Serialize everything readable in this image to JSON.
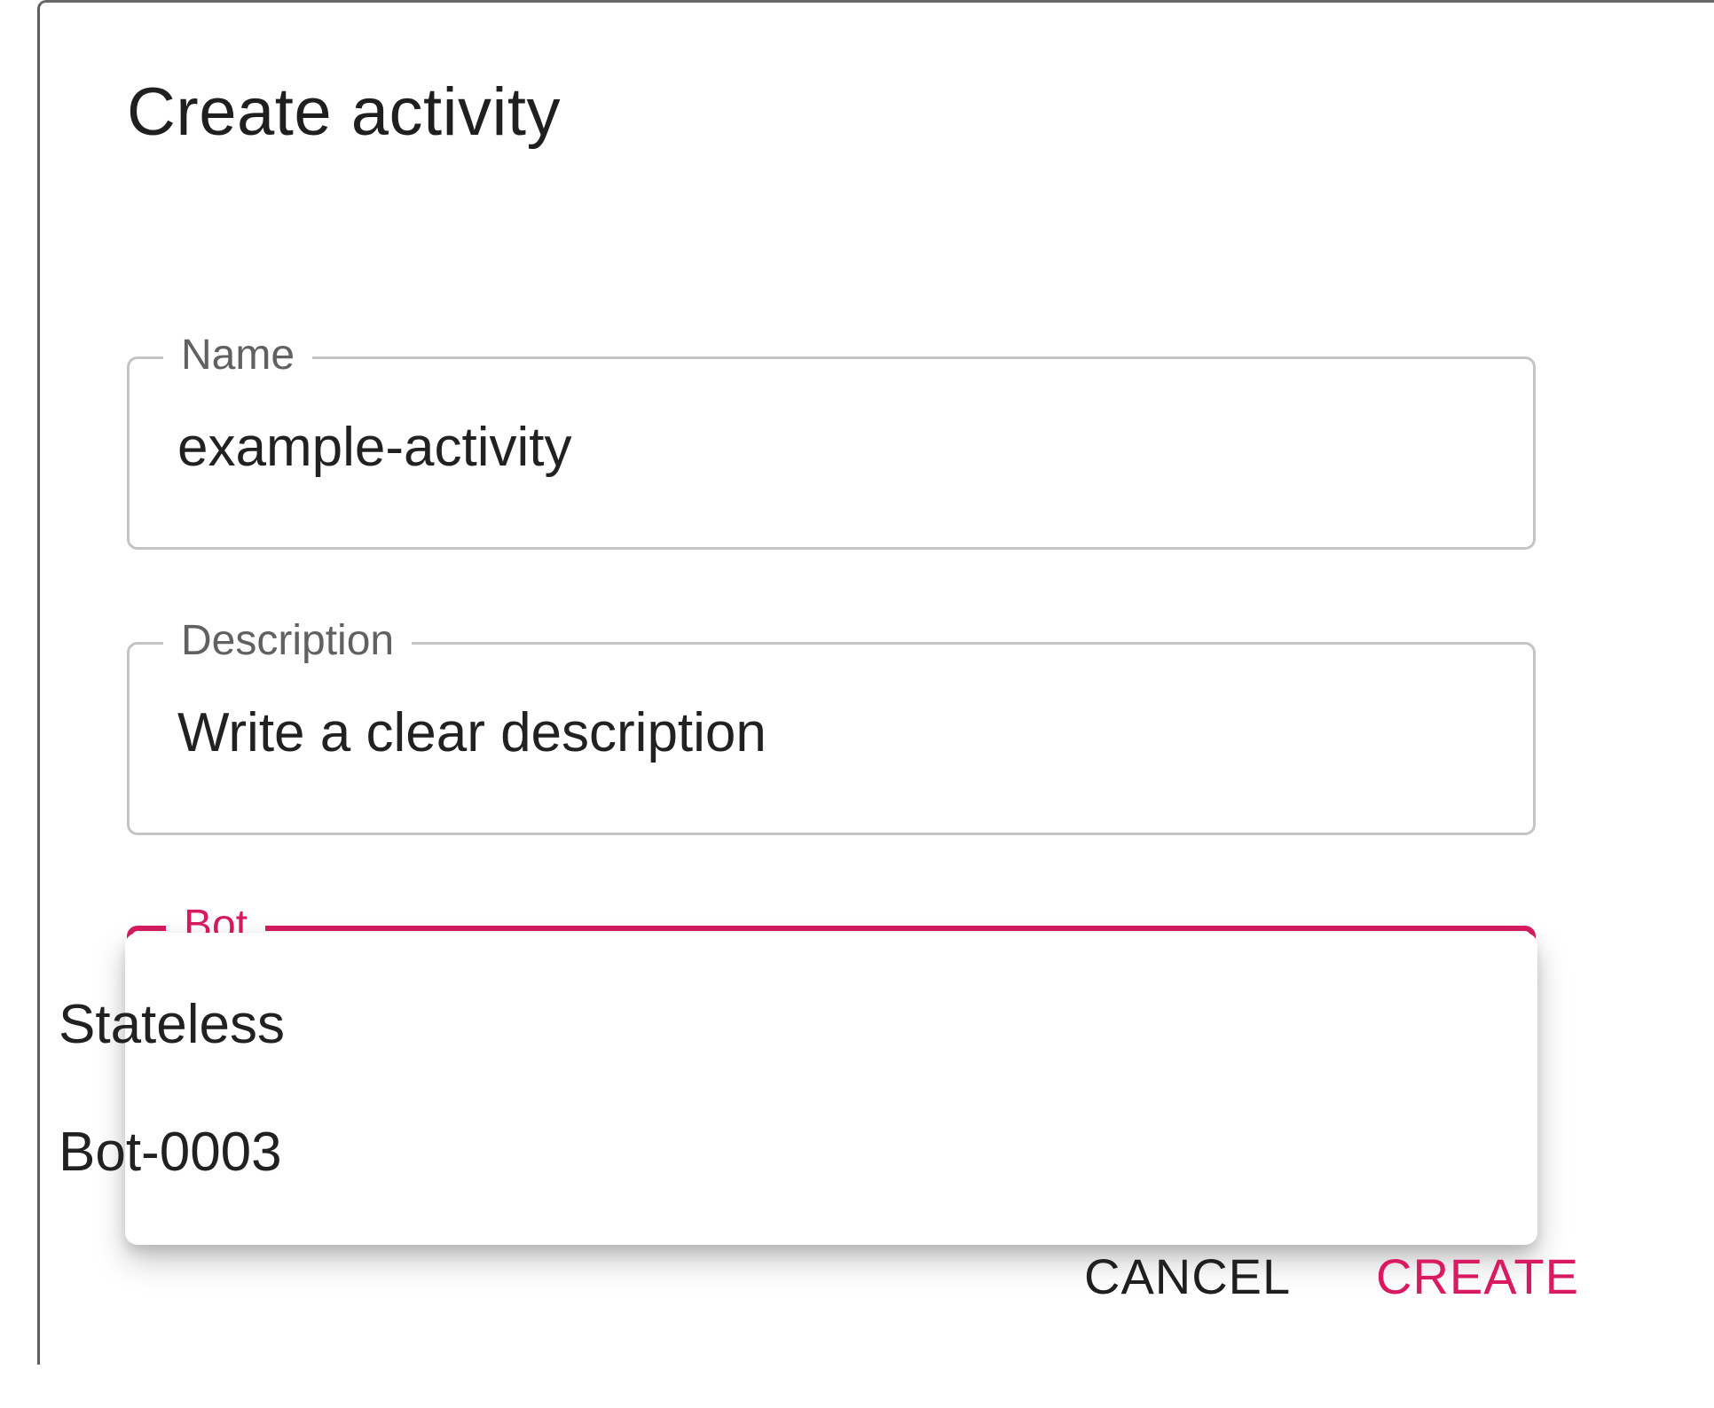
{
  "dialog": {
    "title": "Create activity"
  },
  "fields": {
    "name": {
      "label": "Name",
      "value": "example-activity"
    },
    "description": {
      "label": "Description",
      "value": "Write a clear description"
    },
    "bot": {
      "label": "Bot",
      "options": [
        "Stateless",
        "Bot-0003"
      ]
    }
  },
  "actions": {
    "cancel_label": "CANCEL",
    "create_label": "CREATE"
  },
  "colors": {
    "accent": "#d81b60",
    "border": "#c4c4c4",
    "text": "#212121",
    "label": "#616161"
  }
}
